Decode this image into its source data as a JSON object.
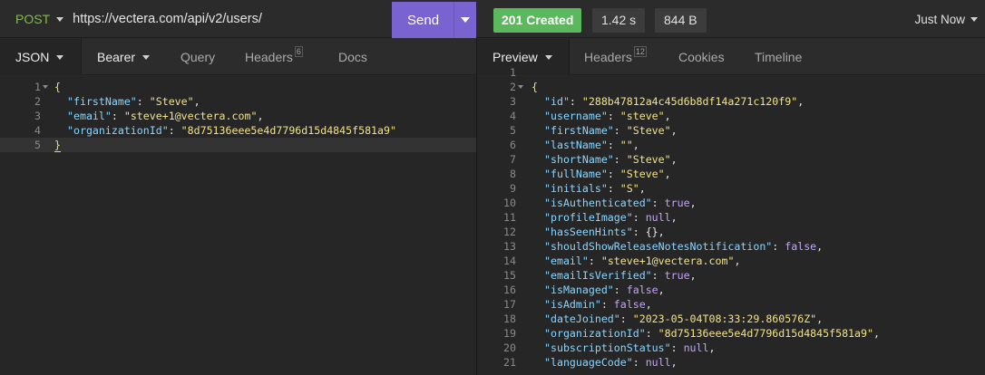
{
  "request": {
    "method": "POST",
    "url": "https://vectera.com/api/v2/users/",
    "send_label": "Send"
  },
  "response_meta": {
    "status": "201 Created",
    "time": "1.42 s",
    "size": "844 B",
    "history": "Just Now",
    "status_color": "#5cb85c"
  },
  "left_tabs": {
    "body": "JSON",
    "auth": "Bearer",
    "query": "Query",
    "headers": "Headers",
    "headers_count": "6",
    "docs": "Docs"
  },
  "right_tabs": {
    "preview": "Preview",
    "headers": "Headers",
    "headers_count": "12",
    "cookies": "Cookies",
    "timeline": "Timeline"
  },
  "request_body": [
    {
      "n": "1",
      "text": "{"
    },
    {
      "n": "2",
      "key": "\"firstName\"",
      "val": "\"Steve\"",
      "end": ","
    },
    {
      "n": "3",
      "key": "\"email\"",
      "val": "\"steve+1@vectera.com\"",
      "end": ","
    },
    {
      "n": "4",
      "key": "\"organizationId\"",
      "val": "\"8d75136eee5e4d7796d15d4845f581a9\"",
      "end": ""
    },
    {
      "n": "5",
      "text": "}"
    }
  ],
  "response_body": [
    {
      "n": "1",
      "text": ""
    },
    {
      "n": "2",
      "text": "{"
    },
    {
      "n": "3",
      "key": "\"id\"",
      "val": "\"288b47812a4c45d6b8df14a271c120f9\"",
      "end": ","
    },
    {
      "n": "4",
      "key": "\"username\"",
      "val": "\"steve\"",
      "end": ","
    },
    {
      "n": "5",
      "key": "\"firstName\"",
      "val": "\"Steve\"",
      "end": ","
    },
    {
      "n": "6",
      "key": "\"lastName\"",
      "val": "\"\"",
      "end": ","
    },
    {
      "n": "7",
      "key": "\"shortName\"",
      "val": "\"Steve\"",
      "end": ","
    },
    {
      "n": "8",
      "key": "\"fullName\"",
      "val": "\"Steve\"",
      "end": ","
    },
    {
      "n": "9",
      "key": "\"initials\"",
      "val": "\"S\"",
      "end": ","
    },
    {
      "n": "10",
      "key": "\"isAuthenticated\"",
      "lit": "true",
      "end": ","
    },
    {
      "n": "11",
      "key": "\"profileImage\"",
      "lit": "null",
      "end": ","
    },
    {
      "n": "12",
      "key": "\"hasSeenHints\"",
      "raw": "{}",
      "end": ","
    },
    {
      "n": "13",
      "key": "\"shouldShowReleaseNotesNotification\"",
      "lit": "false",
      "end": ","
    },
    {
      "n": "14",
      "key": "\"email\"",
      "val": "\"steve+1@vectera.com\"",
      "end": ","
    },
    {
      "n": "15",
      "key": "\"emailIsVerified\"",
      "lit": "true",
      "end": ","
    },
    {
      "n": "16",
      "key": "\"isManaged\"",
      "lit": "false",
      "end": ","
    },
    {
      "n": "17",
      "key": "\"isAdmin\"",
      "lit": "false",
      "end": ","
    },
    {
      "n": "18",
      "key": "\"dateJoined\"",
      "val": "\"2023-05-04T08:33:29.860576Z\"",
      "end": ","
    },
    {
      "n": "19",
      "key": "\"organizationId\"",
      "val": "\"8d75136eee5e4d7796d15d4845f581a9\"",
      "end": ","
    },
    {
      "n": "20",
      "key": "\"subscriptionStatus\"",
      "lit": "null",
      "end": ","
    },
    {
      "n": "21",
      "key": "\"languageCode\"",
      "lit": "null",
      "end": ","
    }
  ]
}
